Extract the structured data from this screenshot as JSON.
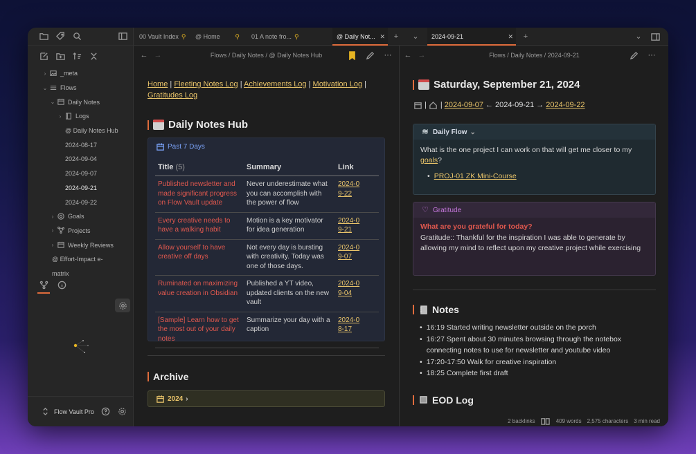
{
  "sidebar": {
    "tree": [
      {
        "label": "_meta",
        "indent": 0,
        "chev": "›",
        "icon": "image"
      },
      {
        "label": "Flows",
        "indent": 0,
        "chev": "⌄",
        "icon": "list"
      },
      {
        "label": "Daily Notes",
        "indent": 1,
        "chev": "⌄",
        "icon": "calendar"
      },
      {
        "label": "Logs",
        "indent": 2,
        "chev": "›",
        "icon": "book"
      },
      {
        "label": "@ Daily Notes Hub",
        "indent": 2,
        "chev": "",
        "icon": ""
      },
      {
        "label": "2024-08-17",
        "indent": 2,
        "chev": "",
        "icon": ""
      },
      {
        "label": "2024-09-04",
        "indent": 2,
        "chev": "",
        "icon": ""
      },
      {
        "label": "2024-09-07",
        "indent": 2,
        "chev": "",
        "icon": ""
      },
      {
        "label": "2024-09-21",
        "indent": 2,
        "chev": "",
        "icon": "",
        "active": true
      },
      {
        "label": "2024-09-22",
        "indent": 2,
        "chev": "",
        "icon": ""
      },
      {
        "label": "Goals",
        "indent": 1,
        "chev": "›",
        "icon": "target"
      },
      {
        "label": "Projects",
        "indent": 1,
        "chev": "›",
        "icon": "network"
      },
      {
        "label": "Weekly Reviews",
        "indent": 1,
        "chev": "›",
        "icon": "calendar"
      },
      {
        "label": "@ Effort-Impact e-",
        "indent": 1,
        "chev": "",
        "icon": ""
      },
      {
        "label": "matrix",
        "indent": 1,
        "chev": "",
        "icon": ""
      }
    ],
    "vault_name": "Flow Vault Pro"
  },
  "tabs": {
    "left": [
      {
        "label": "00 Vault Index",
        "pinned": true
      },
      {
        "label": "@ Home",
        "pinned": false
      },
      {
        "label": "01 A note fro...",
        "pinned": true
      },
      {
        "label": "@ Daily Not...",
        "active": true
      }
    ],
    "right": [
      {
        "label": "2024-09-21",
        "active": true
      }
    ]
  },
  "left_pane": {
    "breadcrumb": "Flows / Daily Notes / @ Daily Notes Hub",
    "links": [
      "Home",
      "Fleeting Notes Log",
      "Achievements Log",
      "Motivation Log",
      "Gratitudes Log"
    ],
    "title": "Daily Notes Hub",
    "callout_title": "Past 7 Days",
    "table": {
      "headers": {
        "title": "Title",
        "count": "(5)",
        "summary": "Summary",
        "link": "Link"
      },
      "rows": [
        {
          "title": "Published newsletter and made significant progress on Flow Vault update",
          "summary": "Never underestimate what you can accomplish with the power of flow",
          "link": "2024-09-22"
        },
        {
          "title": "Every creative needs to have a walking habit",
          "summary": "Motion is a key motivator for idea generation",
          "link": "2024-09-21"
        },
        {
          "title": "Allow yourself to have creative off days",
          "summary": "Not every day is bursting with creativity. Today was one of those days.",
          "link": "2024-09-07"
        },
        {
          "title": "Ruminated on maximizing value creation in Obsidian",
          "summary": "Published a YT video, updated clients on the new vault",
          "link": "2024-09-04"
        },
        {
          "title": "[Sample] Learn how to get the most out of your daily notes",
          "summary": "Summarize your day with a caption",
          "link": "2024-08-17"
        }
      ]
    },
    "archive_title": "Archive",
    "archive_item": "2024"
  },
  "right_pane": {
    "breadcrumb": "Flows / Daily Notes / 2024-09-21",
    "title": "Saturday, September 21, 2024",
    "nav": {
      "prev": "2024-09-07",
      "current": "2024-09-21",
      "next": "2024-09-22",
      "arrow_left": "←",
      "arrow_right": "→"
    },
    "flow_title": "Daily Flow",
    "flow_question_a": "What is the one project I can work on that will get me closer to my ",
    "flow_question_link": "goals",
    "flow_question_b": "?",
    "flow_item": "PROJ-01 ZK Mini-Course",
    "gratitude_title": "Gratitude",
    "gratitude_question": "What are you grateful for today?",
    "gratitude_text": "Gratitude:: Thankful for the inspiration I was able to generate by allowing my mind to reflect upon my creative project while exercising",
    "notes_title": "Notes",
    "notes": [
      "16:19 Started writing newsletter outside on the porch",
      "16:27 Spent about 30 minutes browsing through the notebox connecting notes to use for newsletter and youtube video",
      "17:20-17:50 Walk for creative inspiration",
      "18:25 Complete first draft"
    ],
    "eod_title": "EOD Log"
  },
  "status": {
    "backlinks": "2 backlinks",
    "words": "409 words",
    "chars": "2,575 characters",
    "read": "3 min read"
  },
  "colors": {
    "accent": "#e06c3c",
    "link": "#e9c46a",
    "title_red": "#e0584e",
    "callout_blue": "#7aa2f7",
    "callout_purple": "#c678dd"
  }
}
